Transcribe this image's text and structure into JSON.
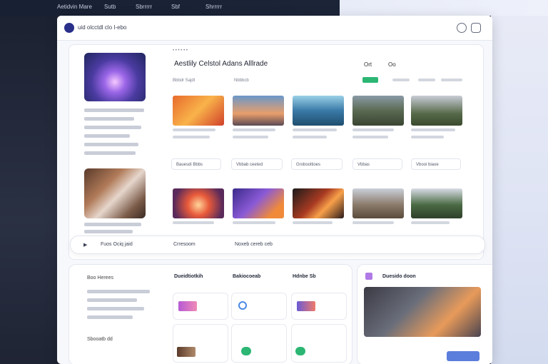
{
  "topbar": {
    "items": [
      "Aetidvin Mare",
      "Sutb",
      "Sbrrrrr",
      "Sbf",
      "Shrrrrr"
    ]
  },
  "header": {
    "brand": "uid olcctdl clo I-ebo",
    "icons": [
      "search-icon",
      "chat-icon"
    ]
  },
  "hero": {
    "title": "Aestlily Celstol Adans Alllrade",
    "tabs": [
      "Ort",
      "Oo"
    ],
    "sub_left": "Bbbdr Sajdl",
    "sub_mid": "Nbbbcb"
  },
  "bar": {
    "left": "Fuos Ociq jaid",
    "right_a": "Crresoom",
    "right_b": "Noxeb cereb ceb"
  },
  "sections": [
    {
      "title": "Dueidtiotkih"
    },
    {
      "title": "Bakiocoeab"
    },
    {
      "title": "Hdnbe Sb"
    },
    {
      "title": "Duesido doon"
    }
  ],
  "left_panel": {
    "labels": [
      "Boo Herees",
      "Sbooatb dd"
    ]
  },
  "cards_row1": [
    "Bauesdi Bbbs",
    "Vbbab ceeted",
    "Grobooltioes",
    "Vbbas",
    "Vbooi biaoe"
  ],
  "colors": {
    "accent_green": "#2bb673",
    "accent_blue": "#5b7ddc",
    "dark_bg": "#1f2433"
  }
}
